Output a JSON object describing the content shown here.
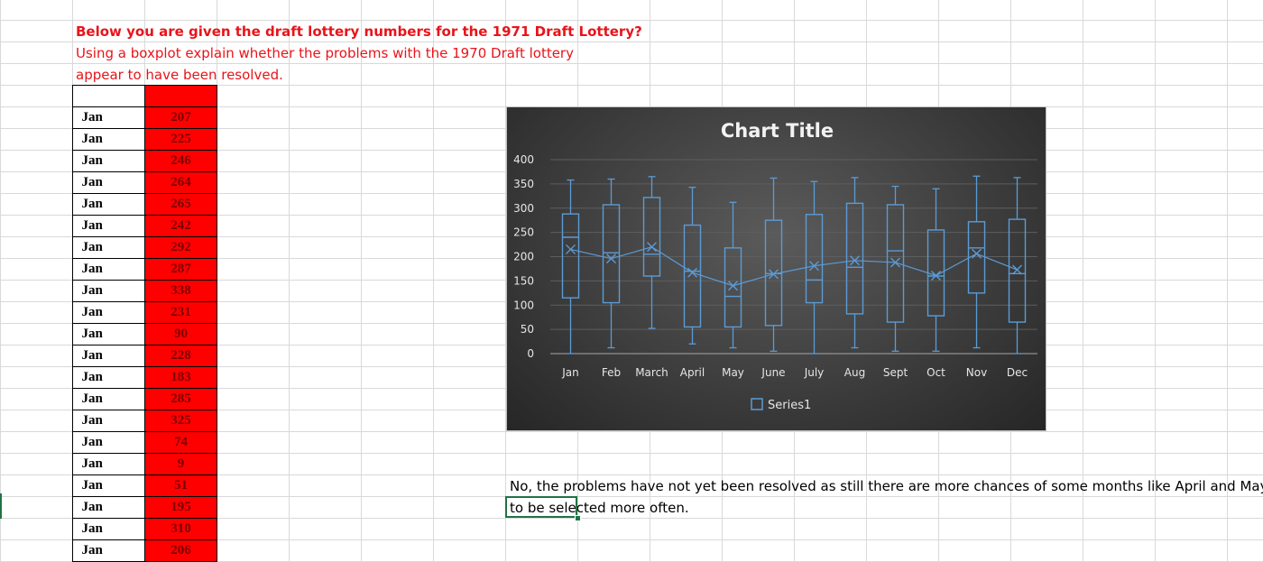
{
  "question": {
    "line1": "Below you are given the draft lottery numbers for the 1971 Draft Lottery?",
    "line2": "Using a boxplot explain whether the problems with the 1970 Draft lottery",
    "line3": "appear to have been resolved."
  },
  "table": {
    "rows": [
      {
        "month": "Jan",
        "value": "207"
      },
      {
        "month": "Jan",
        "value": "225"
      },
      {
        "month": "Jan",
        "value": "246"
      },
      {
        "month": "Jan",
        "value": "264"
      },
      {
        "month": "Jan",
        "value": "265"
      },
      {
        "month": "Jan",
        "value": "242"
      },
      {
        "month": "Jan",
        "value": "292"
      },
      {
        "month": "Jan",
        "value": "287"
      },
      {
        "month": "Jan",
        "value": "338"
      },
      {
        "month": "Jan",
        "value": "231"
      },
      {
        "month": "Jan",
        "value": "90"
      },
      {
        "month": "Jan",
        "value": "228"
      },
      {
        "month": "Jan",
        "value": "183"
      },
      {
        "month": "Jan",
        "value": "285"
      },
      {
        "month": "Jan",
        "value": "325"
      },
      {
        "month": "Jan",
        "value": "74"
      },
      {
        "month": "Jan",
        "value": "9"
      },
      {
        "month": "Jan",
        "value": "51"
      },
      {
        "month": "Jan",
        "value": "195"
      },
      {
        "month": "Jan",
        "value": "310"
      },
      {
        "month": "Jan",
        "value": "206"
      }
    ]
  },
  "answer": {
    "line1": "No, the problems have not yet been resolved as still there are more chances of some months like April and May",
    "line2": "to be selected more often."
  },
  "colors": {
    "question": "#e8141a",
    "cell_fill": "#ff0000",
    "series": "#5b9bd5",
    "chart_bg": "#404040"
  },
  "chart_data": {
    "type": "boxplot",
    "title": "Chart Title",
    "legend": [
      "Series1"
    ],
    "legend_position": "bottom",
    "ylim": [
      0,
      400
    ],
    "yticks": [
      0,
      50,
      100,
      150,
      200,
      250,
      300,
      350,
      400
    ],
    "grid": true,
    "categories": [
      "Jan",
      "Feb",
      "March",
      "April",
      "May",
      "June",
      "July",
      "Aug",
      "Sept",
      "Oct",
      "Nov",
      "Dec"
    ],
    "series": [
      {
        "name": "Series1",
        "boxes": [
          {
            "min": 0,
            "q1": 115,
            "median": 240,
            "q3": 288,
            "max": 358,
            "mean": 215
          },
          {
            "min": 12,
            "q1": 105,
            "median": 208,
            "q3": 307,
            "max": 360,
            "mean": 196
          },
          {
            "min": 52,
            "q1": 160,
            "median": 205,
            "q3": 322,
            "max": 365,
            "mean": 220
          },
          {
            "min": 20,
            "q1": 55,
            "median": 170,
            "q3": 265,
            "max": 343,
            "mean": 167
          },
          {
            "min": 12,
            "q1": 55,
            "median": 118,
            "q3": 218,
            "max": 312,
            "mean": 140
          },
          {
            "min": 5,
            "q1": 58,
            "median": 165,
            "q3": 275,
            "max": 362,
            "mean": 164
          },
          {
            "min": 0,
            "q1": 105,
            "median": 152,
            "q3": 287,
            "max": 355,
            "mean": 181
          },
          {
            "min": 12,
            "q1": 82,
            "median": 178,
            "q3": 310,
            "max": 363,
            "mean": 192
          },
          {
            "min": 5,
            "q1": 65,
            "median": 212,
            "q3": 307,
            "max": 345,
            "mean": 188
          },
          {
            "min": 5,
            "q1": 78,
            "median": 160,
            "q3": 255,
            "max": 340,
            "mean": 161
          },
          {
            "min": 12,
            "q1": 125,
            "median": 218,
            "q3": 272,
            "max": 366,
            "mean": 206
          },
          {
            "min": 0,
            "q1": 65,
            "median": 165,
            "q3": 277,
            "max": 363,
            "mean": 173
          }
        ]
      }
    ]
  }
}
